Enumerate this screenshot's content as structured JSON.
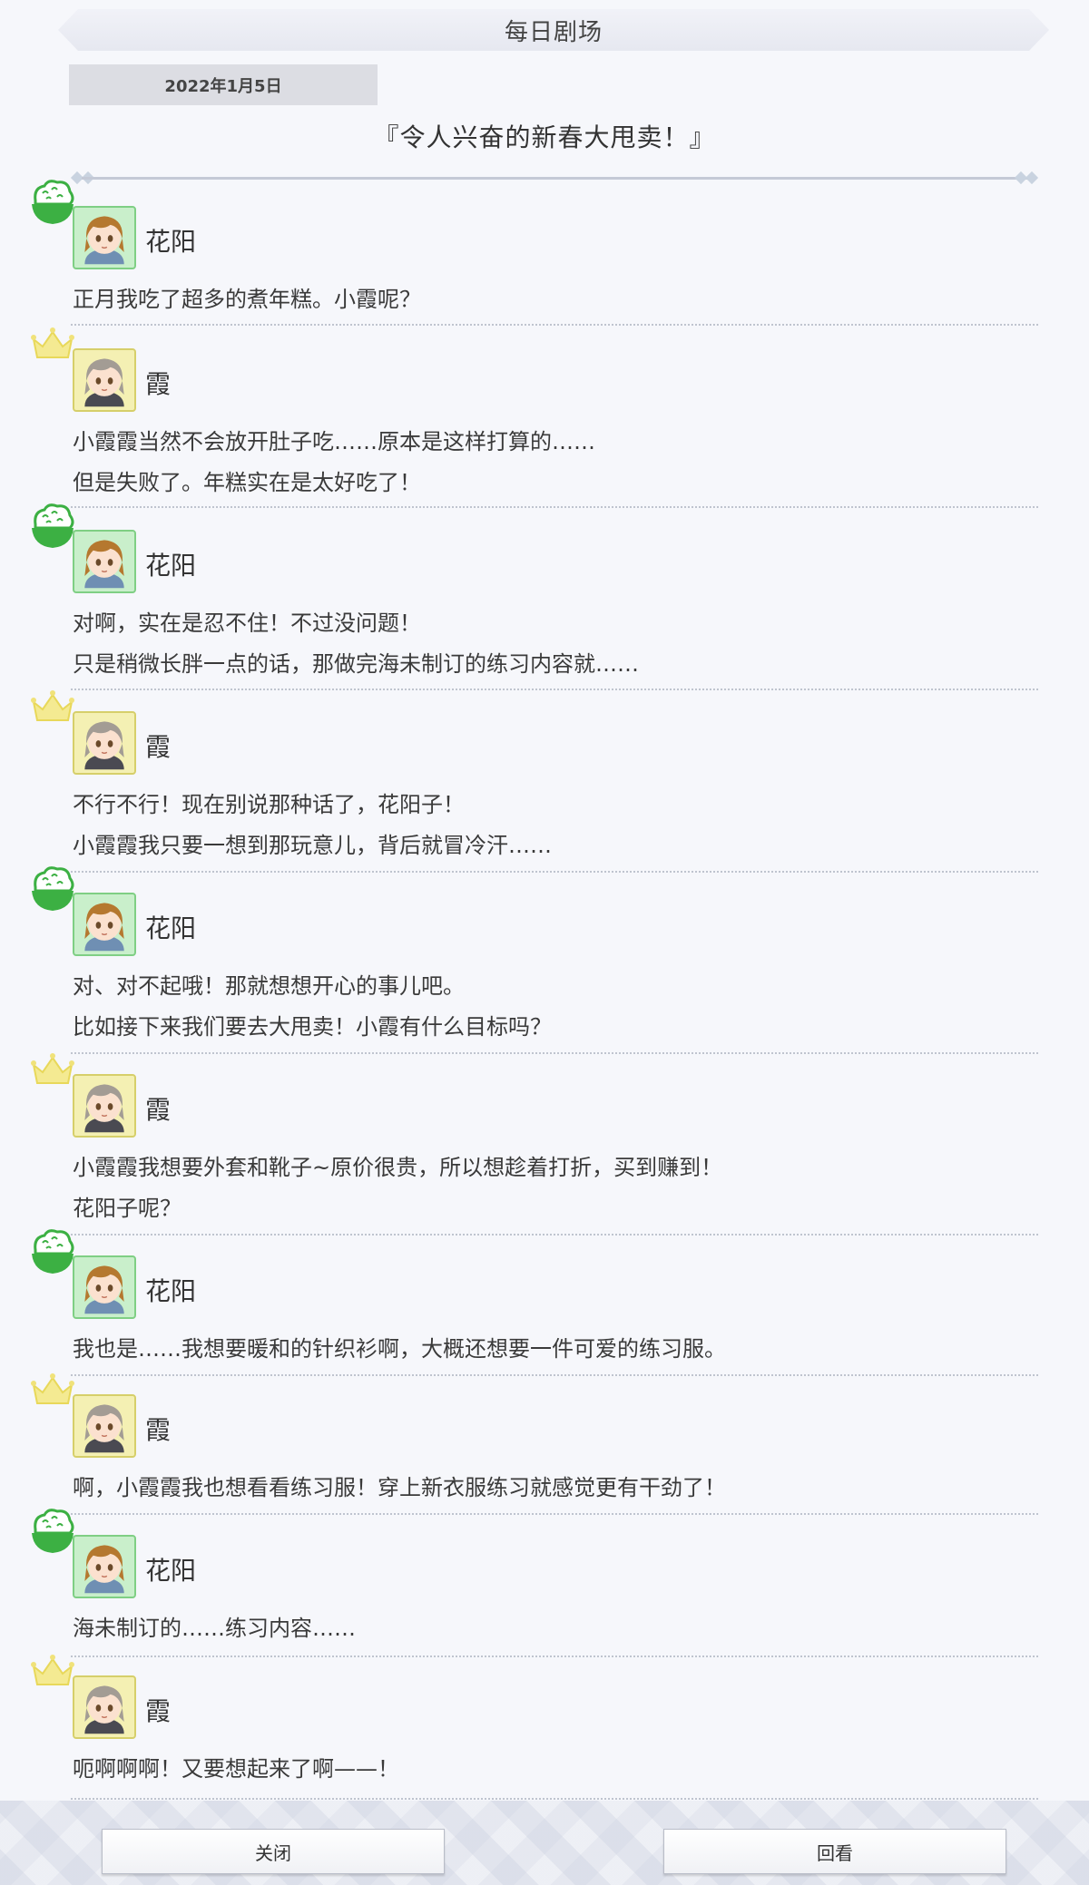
{
  "header": {
    "title": "每日剧场"
  },
  "date": "2022年1月5日",
  "story_title": "『令人兴奋的新春大甩卖！』",
  "entries": [
    {
      "speaker": "花阳",
      "lines": [
        "正月我吃了超多的煮年糕。小霞呢？"
      ]
    },
    {
      "speaker": "霞",
      "lines": [
        "小霞霞当然不会放开肚子吃……原本是这样打算的……",
        "但是失败了。年糕实在是太好吃了！"
      ]
    },
    {
      "speaker": "花阳",
      "lines": [
        "对啊，实在是忍不住！不过没问题！",
        "只是稍微长胖一点的话，那做完海未制订的练习内容就……"
      ]
    },
    {
      "speaker": "霞",
      "lines": [
        "不行不行！现在别说那种话了，花阳子！",
        "小霞霞我只要一想到那玩意儿，背后就冒冷汗……"
      ]
    },
    {
      "speaker": "花阳",
      "lines": [
        "对、对不起哦！那就想想开心的事儿吧。",
        "比如接下来我们要去大甩卖！小霞有什么目标吗？"
      ]
    },
    {
      "speaker": "霞",
      "lines": [
        "小霞霞我想要外套和靴子~原价很贵，所以想趁着打折，买到赚到！",
        "花阳子呢？"
      ]
    },
    {
      "speaker": "花阳",
      "lines": [
        "我也是……我想要暖和的针织衫啊，大概还想要一件可爱的练习服。"
      ]
    },
    {
      "speaker": "霞",
      "lines": [
        "啊，小霞霞我也想看看练习服！穿上新衣服练习就感觉更有干劲了！"
      ]
    },
    {
      "speaker": "花阳",
      "lines": [
        "海未制订的……练习内容……"
      ]
    },
    {
      "speaker": "霞",
      "lines": [
        "呃啊啊啊！又要想起来了啊——！"
      ]
    }
  ],
  "footer": {
    "close_label": "关闭",
    "replay_label": "回看"
  },
  "icons": {
    "hanayo_emblem": "rice-bowl-icon",
    "kasumi_emblem": "crown-icon"
  },
  "colors": {
    "hanayo": "#3cb043",
    "kasumi": "#f0e27a"
  }
}
